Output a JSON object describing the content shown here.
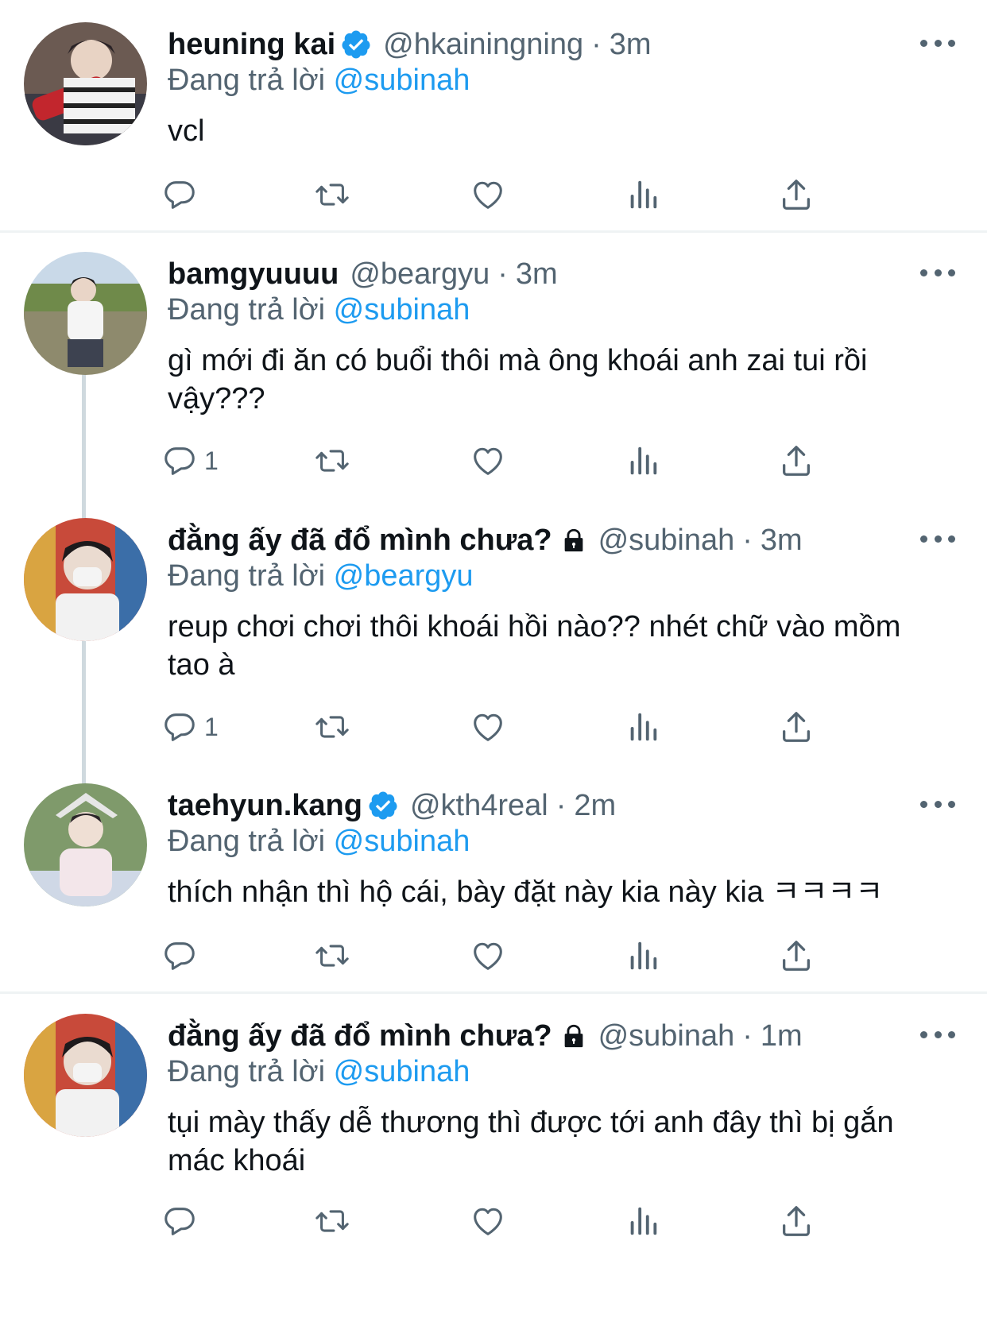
{
  "reply_prefix": "Đang trả lời",
  "colors": {
    "accent": "#1d9bf0",
    "secondary": "#536471",
    "text": "#0f1419",
    "divider": "#eff3f4",
    "thread_line": "#cfd9de"
  },
  "tweets": [
    {
      "name": "heuning kai",
      "verified": true,
      "locked": false,
      "handle": "@hkainingning",
      "time": "3m",
      "reply_to": "@subinah",
      "text": "vcl",
      "reply_count": ""
    },
    {
      "name": "bamgyuuuu",
      "verified": false,
      "locked": false,
      "handle": "@beargyu",
      "time": "3m",
      "reply_to": "@subinah",
      "text": "gì mới đi ăn có buổi thôi mà ông khoái anh zai tui rồi vậy???",
      "reply_count": "1"
    },
    {
      "name": "đằng ấy đã đổ mình chưa?",
      "verified": false,
      "locked": true,
      "handle": "@subinah",
      "time": "3m",
      "reply_to": "@beargyu",
      "text": "reup chơi chơi thôi khoái hồi nào?? nhét chữ vào mồm tao à",
      "reply_count": "1"
    },
    {
      "name": "taehyun.kang",
      "verified": true,
      "locked": false,
      "handle": "@kth4real",
      "time": "2m",
      "reply_to": "@subinah",
      "text": "thích nhận thì hộ cái, bày đặt này kia này kia ㅋㅋㅋㅋ",
      "reply_count": ""
    },
    {
      "name": "đằng ấy đã đổ mình chưa?",
      "verified": false,
      "locked": true,
      "handle": "@subinah",
      "time": "1m",
      "reply_to": "@subinah",
      "text": "tụi mày thấy dễ thương thì được tới anh đây thì bị gắn mác khoái",
      "reply_count": ""
    }
  ]
}
